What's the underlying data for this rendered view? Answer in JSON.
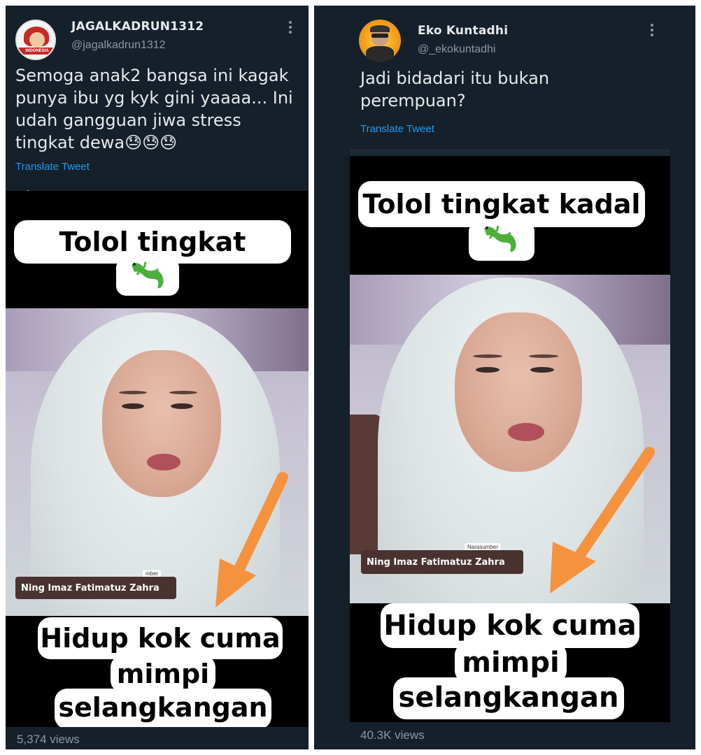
{
  "tweets": [
    {
      "author_name": "JAGALKADRUN1312",
      "handle": "@jagalkadrun1312",
      "text": "Semoga anak2 bangsa ini kagak punya ibu yg kyk gini yaaaa... Ini udah gangguan jiwa stress tingkat dewa😓😓😓",
      "translate_label": "Translate Tweet",
      "video": {
        "top_caption": "Tolol tingkat kadal",
        "name_tag": "Ning Imaz Fatimatuz Zahra",
        "name_tag_label": "mber",
        "bottom_caption_1": "Hidup kok cuma",
        "bottom_caption_2": "mimpi",
        "bottom_caption_3": "selangkangan"
      },
      "views": "5,374 views",
      "avatar_text": "INDONESIA"
    },
    {
      "author_name": "Eko Kuntadhi",
      "handle": "@_ekokuntadhi",
      "text": "Jadi bidadari itu bukan perempuan?",
      "translate_label": "Translate Tweet",
      "video": {
        "top_caption": "Tolol tingkat kadal",
        "name_tag": "Ning Imaz Fatimatuz Zahra",
        "name_tag_label": "Narasumber",
        "bottom_caption_1": "Hidup kok cuma",
        "bottom_caption_2": "mimpi",
        "bottom_caption_3": "selangkangan"
      },
      "views": "40.3K views"
    }
  ],
  "colors": {
    "background": "#15202b",
    "text": "#e7e9ea",
    "secondary_text": "#8b98a5",
    "link": "#1d9bf0",
    "arrow": "#f5923e",
    "lizard": "#4caf3a"
  },
  "icons": [
    "more-options-icon",
    "lizard-emoji-icon",
    "arrow-icon"
  ]
}
